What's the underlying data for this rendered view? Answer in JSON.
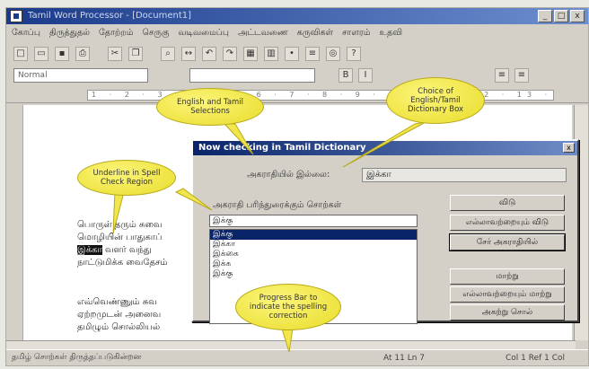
{
  "window": {
    "title": "Tamil Word Processor - [Document1]",
    "controls": [
      "_",
      "□",
      "x"
    ]
  },
  "menu": [
    "கோப்பு",
    "திருத்துதல்",
    "தோற்றம்",
    "செருகு",
    "வடிவமைப்பு",
    "அட்டவணை",
    "கருவிகள்",
    "சாளரம்",
    "உதவி"
  ],
  "format": {
    "style": "Normal"
  },
  "ruler": {
    "marks": "1 · 2 · 3 · 4 · 5 · 6 · 7 · 8 · 9 · 10 · 11 · 12 · 13 · 14"
  },
  "document": {
    "lines": [
      "பொருள் தரும் சுவை",
      "மொழியின் பாதுகாப்",
      "இக்கா வளர் வந்து",
      "நாட்டுமிக்க வைதேசம்",
      "எவ்வெண்ணும் சுவ",
      "ஏற்றமுடன் அனைவ",
      "தமிழும் சொல்லியல்"
    ],
    "highlighted": "இக்கா"
  },
  "dialog": {
    "title": "Now checking in Tamil Dictionary",
    "close": "x",
    "not_found_label": "அகராதியில் இல்லை:",
    "not_found_value": "இக்கா",
    "suggestions_label": "அகராதி பரிந்துரைக்கும் சொற்கள்",
    "suggestion_input": "இக்கு",
    "suggestions": [
      "இக்கு",
      "இக்கா",
      "இக்கை",
      "இக்க",
      "இக்கு"
    ],
    "buttons": [
      "விடு",
      "எல்லாவற்றையும் விடு",
      "சேர் அகராதியில்",
      "மாற்று",
      "எல்லாவற்றையும் மாற்று",
      "அகற்று சொல்"
    ]
  },
  "status": {
    "left": "தமிழ் சொற்கள் திருத்தப்படுகின்றன",
    "position": "At 11 Ln 7",
    "page": "Col 1  Ref 1 Col"
  },
  "callouts": {
    "english_tamil": "English and Tamil Selections",
    "choice": "Choice of English/Tamil Dictionary Box",
    "underline": "Underline in Spell Check Region",
    "progress": "Progress Bar to indicate the spelling correction"
  }
}
